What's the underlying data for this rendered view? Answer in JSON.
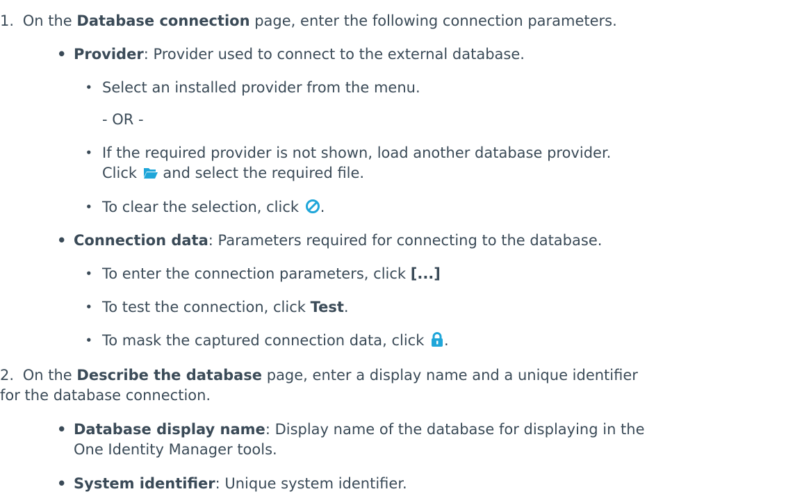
{
  "steps": [
    {
      "number": "1.",
      "pre": "On the ",
      "bold": "Database connection",
      "post": " page, enter the following connection parameters.",
      "items": [
        {
          "label": "Provider",
          "desc": ": Provider used to connect to the external database.",
          "sub": [
            {
              "text": "Select an installed provider from the menu."
            },
            {
              "text": "- OR -"
            },
            {
              "line1": "If the required provider is not shown, load another database provider.",
              "pre": "Click ",
              "post": " and select the required file.",
              "icon": "folder-open-icon"
            },
            {
              "pre": "To clear the selection, click ",
              "post": ".",
              "icon": "clear-circle-icon"
            }
          ]
        },
        {
          "label": "Connection data",
          "desc": ": Parameters required for connecting to the database.",
          "sub": [
            {
              "pre": "To enter the connection parameters, click ",
              "bold": "[...]"
            },
            {
              "pre": "To test the connection, click ",
              "bold": "Test",
              "post": "."
            },
            {
              "pre": "To mask the captured connection data, click ",
              "post": ".",
              "icon": "lock-icon"
            }
          ]
        }
      ]
    },
    {
      "number": "2.",
      "pre": "On the ",
      "bold": "Describe the database",
      "post": " page, enter a display name and a unique identifier",
      "line2": "for the database connection.",
      "items": [
        {
          "label": "Database display name",
          "desc": ": Display name of the database for displaying in the",
          "line2": "One Identity Manager tools."
        },
        {
          "label": "System identifier",
          "desc": ": Unique system identifier."
        }
      ]
    }
  ],
  "colors": {
    "text": "#3a4a57",
    "icon": "#1fa6d9"
  }
}
